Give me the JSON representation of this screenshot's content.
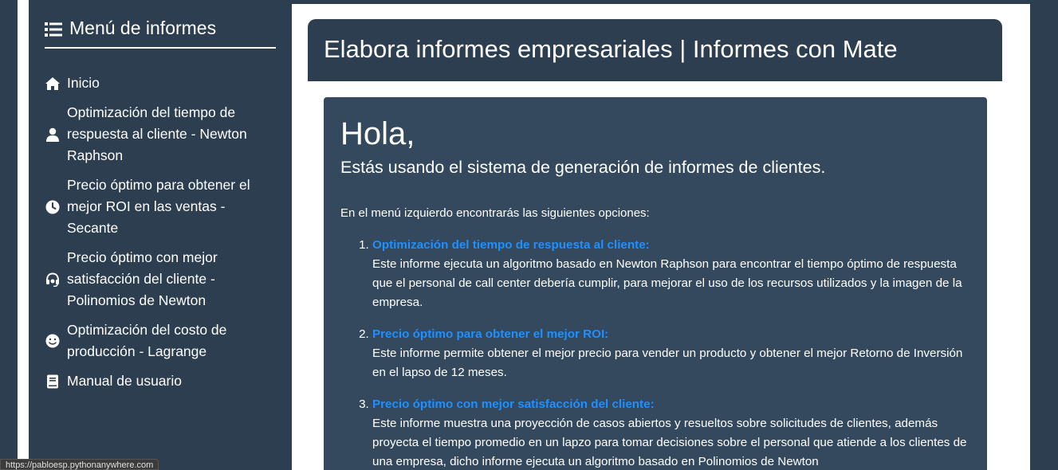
{
  "sidebar": {
    "title": "Menú de informes",
    "items": [
      {
        "label": "Inicio",
        "icon": "home-icon"
      },
      {
        "label": "Optimización del tiempo de respuesta al cliente - Newton Raphson",
        "icon": "user-icon"
      },
      {
        "label": "Precio óptimo para obtener el mejor ROI en las ventas - Secante",
        "icon": "clock-icon"
      },
      {
        "label": "Precio óptimo con mejor satisfacción del cliente - Polinomios de Newton",
        "icon": "headset-icon"
      },
      {
        "label": "Optimización del costo de producción - Lagrange",
        "icon": "smile-icon"
      },
      {
        "label": "Manual de usuario",
        "icon": "book-icon"
      }
    ]
  },
  "header": {
    "title": "Elabora informes empresariales | Informes con Mate"
  },
  "main": {
    "greeting": "Hola,",
    "subtitle": "Estás usando el sistema de generación de informes de clientes.",
    "intro": "En el menú izquierdo encontrarás las siguientes opciones:",
    "options": [
      {
        "title": "Optimización del tiempo de respuesta al cliente:",
        "description": "Este informe ejecuta un algoritmo basado en Newton Raphson para encontrar el tiempo óptimo de respuesta que el personal de call center debería cumplir, para mejorar el uso de los recursos utilizados y la imagen de la empresa."
      },
      {
        "title": "Precio óptimo para obtener el mejor ROI:",
        "description": "Este informe permite obtener el mejor precio para vender un producto y obtener el mejor Retorno de Inversión en el lapso de 12 meses."
      },
      {
        "title": "Precio óptimo con mejor satisfacción del cliente:",
        "description": "Este informe muestra una proyección de casos abiertos y resueltos sobre solicitudes de clientes, además proyecta el tiempo promedio en un lapzo para tomar decisiones sobre el personal que atiende a los clientes de una empresa, dicho informe ejecuta un algoritmo basado en Polinomios de Newton"
      }
    ]
  },
  "status": {
    "url": "https://pabloesp.pythonanywhere.com"
  },
  "colors": {
    "sidebar_bg": "#2c3e50",
    "card_bg": "#34495e",
    "link": "#1e90ff"
  }
}
